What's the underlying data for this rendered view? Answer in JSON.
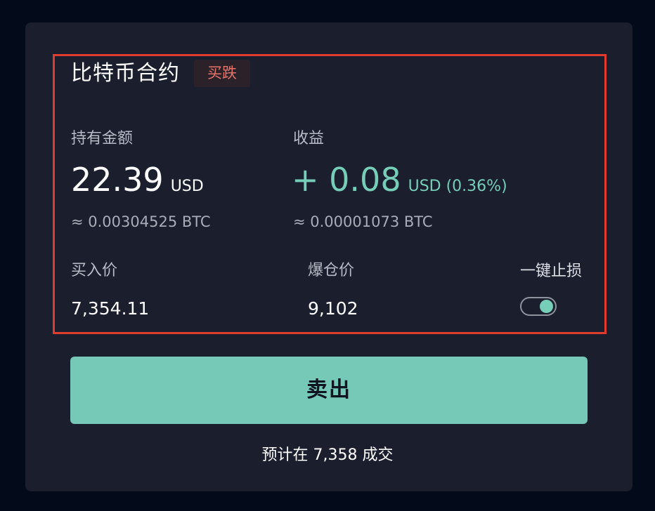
{
  "contract": {
    "title": "比特币合约",
    "direction_tag": "买跌"
  },
  "holding": {
    "label": "持有金额",
    "amount": "22.39",
    "unit": "USD",
    "btc_equiv": "≈ 0.00304525 BTC"
  },
  "profit": {
    "label": "收益",
    "amount": "+ 0.08",
    "unit": "USD (0.36%)",
    "btc_equiv": "≈ 0.00001073 BTC"
  },
  "buy_price": {
    "label": "买入价",
    "value": "7,354.11"
  },
  "liquidation_price": {
    "label": "爆仓价",
    "value": "9,102"
  },
  "stop_loss": {
    "label": "一键止损",
    "enabled": true
  },
  "actions": {
    "sell_label": "卖出",
    "estimate_note": "预计在 7,358 成交"
  },
  "colors": {
    "background": "#030a1a",
    "card": "#1a1e2d",
    "accent_green": "#76cdb8",
    "tag_red": "#e8736b",
    "highlight_border": "#e03b2f"
  }
}
